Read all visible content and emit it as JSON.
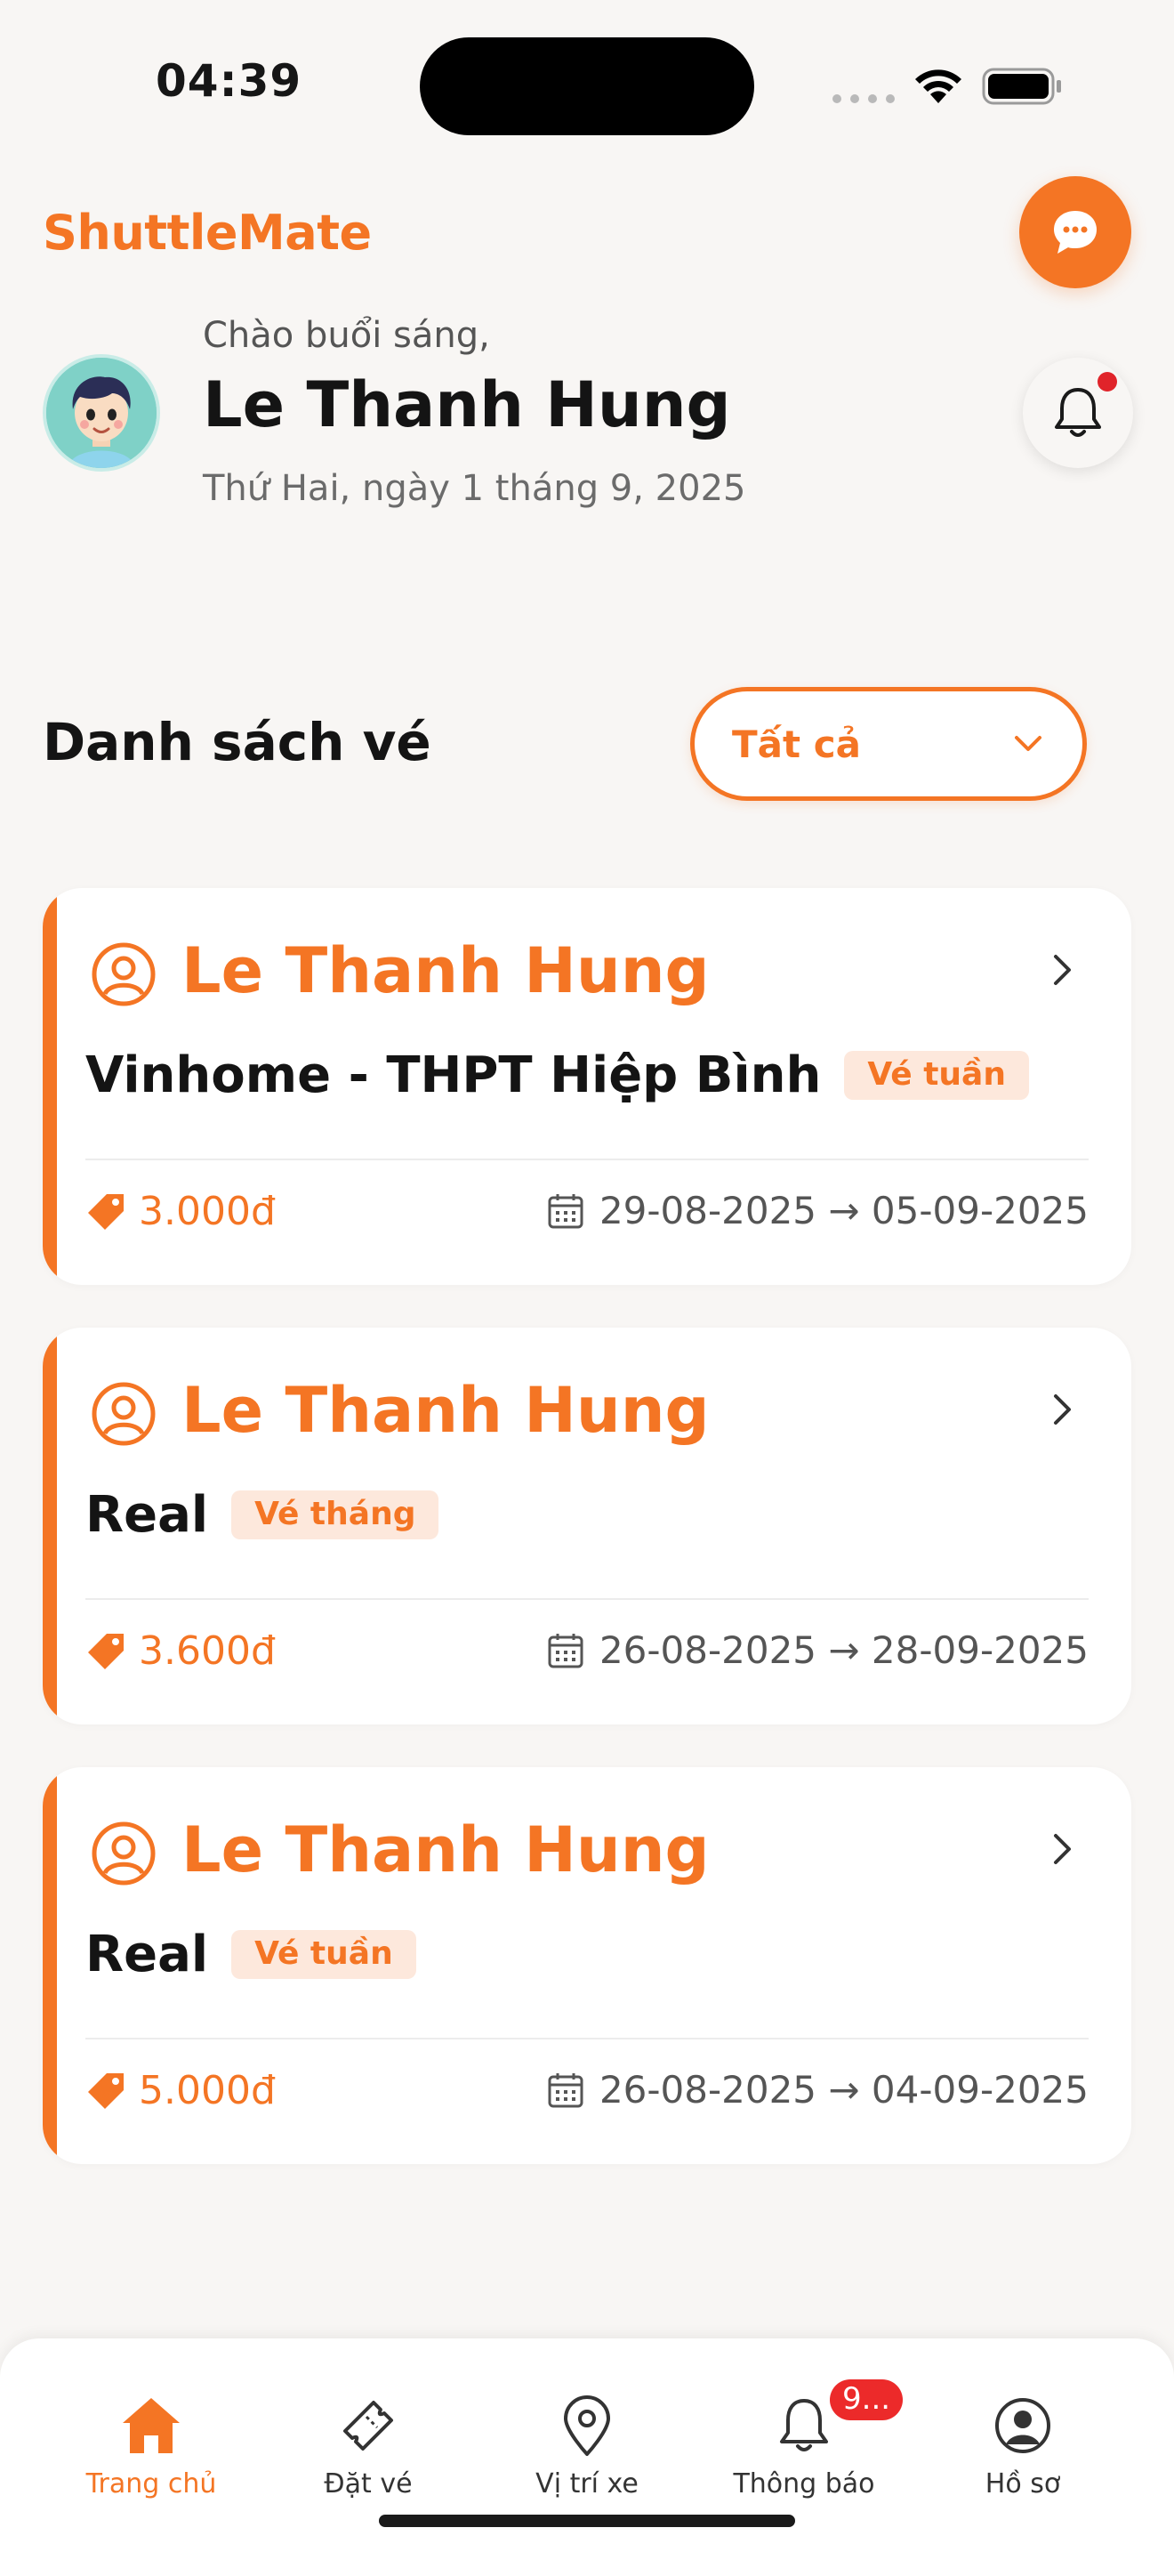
{
  "status_bar": {
    "time": "04:39"
  },
  "header": {
    "brand": "ShuttleMate",
    "greeting": "Chào buổi sáng,",
    "user_name": "Le Thanh Hung",
    "date": "Thứ Hai, ngày 1 tháng 9, 2025"
  },
  "tickets_section": {
    "title": "Danh sách vé",
    "filter_selected": "Tất cả"
  },
  "tickets": [
    {
      "passenger": "Le Thanh Hung",
      "route": "Vinhome - THPT Hiệp Bình",
      "type": "Vé tuần",
      "price": "3.000đ",
      "dates": "29-08-2025 → 05-09-2025"
    },
    {
      "passenger": "Le Thanh Hung",
      "route": "Real",
      "type": "Vé tháng",
      "price": "3.600đ",
      "dates": "26-08-2025 → 28-09-2025"
    },
    {
      "passenger": "Le Thanh Hung",
      "route": "Real",
      "type": "Vé tuần",
      "price": "5.000đ",
      "dates": "26-08-2025 → 04-09-2025"
    }
  ],
  "bottom_nav": {
    "items": [
      {
        "label": "Trang chủ",
        "icon": "home-icon",
        "active": true
      },
      {
        "label": "Đặt vé",
        "icon": "ticket-icon"
      },
      {
        "label": "Vị trí xe",
        "icon": "location-pin-icon"
      },
      {
        "label": "Thông báo",
        "icon": "bell-icon",
        "badge": "9..."
      },
      {
        "label": "Hồ sơ",
        "icon": "profile-icon"
      }
    ]
  },
  "colors": {
    "accent": "#f47524",
    "background": "#f8f6f4",
    "badge_red": "#ec2a2a"
  }
}
